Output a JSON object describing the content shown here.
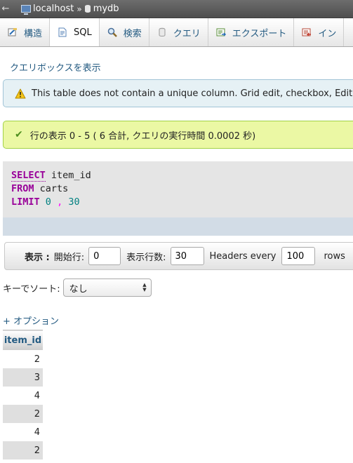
{
  "breadcrumb": {
    "back": "←",
    "server": "localhost",
    "separator": "»",
    "database": "mydb"
  },
  "tabs": [
    {
      "label": "構造",
      "icon": "structure-icon"
    },
    {
      "label": "SQL",
      "icon": "sql-icon",
      "active": true
    },
    {
      "label": "検索",
      "icon": "search-icon"
    },
    {
      "label": "クエリ",
      "icon": "query-icon"
    },
    {
      "label": "エクスポート",
      "icon": "export-icon"
    },
    {
      "label": "イン",
      "icon": "import-icon"
    }
  ],
  "querybox_link": "クエリボックスを表示",
  "notice": {
    "text": "This table does not contain a unique column. Grid edit, checkbox, Edit, C",
    "icon": "warning-icon"
  },
  "success": {
    "text": "行の表示 0 - 5 ( 6 合計, クエリの実行時間 0.0002 秒)",
    "icon": "check-icon"
  },
  "sql": {
    "line1_kw": "SELECT",
    "line1_rest": " item_id",
    "line2_kw": "FROM",
    "line2_rest": " carts",
    "line3_kw": "LIMIT",
    "line3_n1": "0",
    "line3_comma": ",",
    "line3_n2": "30"
  },
  "nav": {
    "display_label": "表示 :",
    "start_label": "開始行:",
    "start_value": "0",
    "rows_label": "表示行数:",
    "rows_value": "30",
    "headers_label": "Headers every",
    "headers_value": "100",
    "rows_suffix": "rows"
  },
  "sort": {
    "label": "キーでソート:",
    "value": "なし"
  },
  "options_link": "+ オプション",
  "table": {
    "column": "item_id",
    "rows": [
      "2",
      "3",
      "4",
      "2",
      "4",
      "2"
    ]
  },
  "colors": {
    "link": "#235a81",
    "keyword": "#990099",
    "number": "#008080",
    "notice_bg": "#e6f1f5",
    "success_bg": "#ebf8a4"
  }
}
